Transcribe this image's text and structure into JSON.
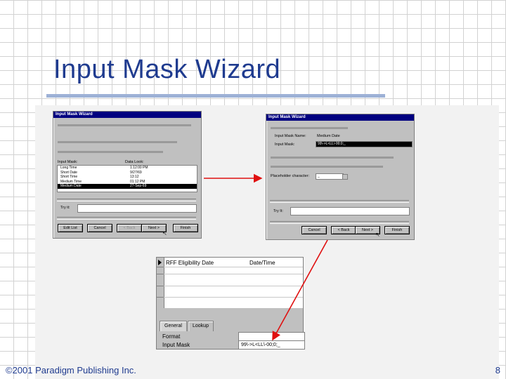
{
  "slide": {
    "title": "Input Mask Wizard",
    "footer_left": "©2001 Paradigm Publishing Inc.",
    "page_number": "8"
  },
  "dialog1": {
    "title": "Input Mask Wizard",
    "list_headers": [
      "Input Mask:",
      "Data Look:"
    ],
    "rows": [
      [
        "Long Time",
        "1:12:00 PM"
      ],
      [
        "Short Date",
        "9/27/69"
      ],
      [
        "Short Time",
        "13:12"
      ],
      [
        "Medium Time",
        "01:12 PM"
      ],
      [
        "Medium Date",
        "27-Sep-69"
      ]
    ],
    "selected_row": 4,
    "try_it_label": "Try it:",
    "buttons": [
      "Edit List",
      "Cancel",
      "< Back",
      "Next >",
      "Finish"
    ]
  },
  "dialog2": {
    "title": "Input Mask Wizard",
    "mask_name_label": "Input Mask Name:",
    "mask_name_value": "Medium Date",
    "input_mask_label": "Input Mask:",
    "input_mask_value": "99\\->L<LL\\-00;0;_",
    "placeholder_label": "Placeholder character:",
    "placeholder_value": "_",
    "try_it_label": "Try It:",
    "buttons": [
      "Cancel",
      "< Back",
      "Next >",
      "Finish"
    ]
  },
  "design": {
    "field_name": "RFF Eligibility Date",
    "data_type": "Date/Time",
    "tabs": [
      "General",
      "Lookup"
    ],
    "props": [
      {
        "label": "Format",
        "value": ""
      },
      {
        "label": "Input Mask",
        "value": "99\\->L<LL\\-00;0;_"
      }
    ]
  },
  "colors": {
    "title": "#1f3b8f",
    "arrow": "#e01010",
    "titlebar": "#000080"
  }
}
